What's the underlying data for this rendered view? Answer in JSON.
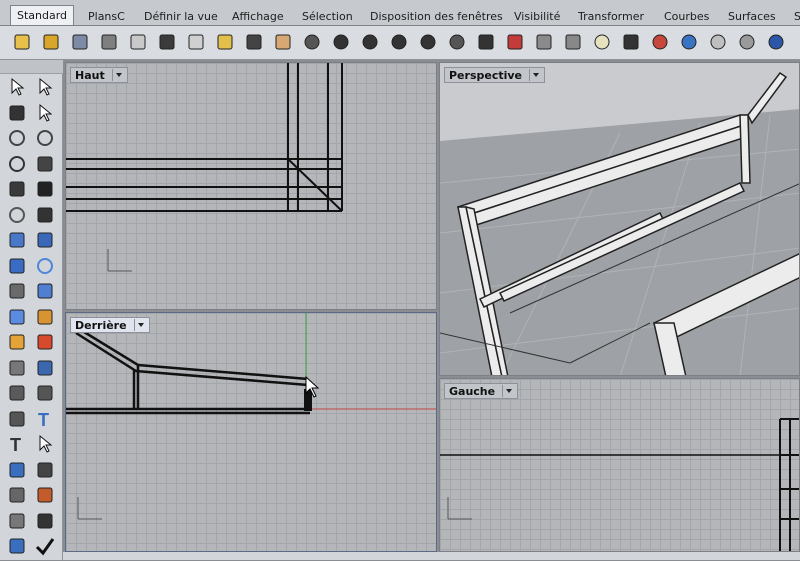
{
  "tabs": [
    "Standard",
    "PlansC",
    "Définir la vue",
    "Affichage",
    "Sélection",
    "Disposition des fenêtres",
    "Visibilité",
    "Transformer",
    "Courbes",
    "Surfaces",
    "S"
  ],
  "active_tab": "Standard",
  "toolbar_icons": [
    "new-file-icon",
    "open-folder-icon",
    "save-icon",
    "print-icon",
    "import-icon",
    "cut-icon",
    "copy-icon",
    "paste-icon",
    "undo-icon",
    "pan-hand-icon",
    "rotate-view-icon",
    "zoom-icon",
    "zoom-window-icon",
    "zoom-extents-icon",
    "zoom-selected-icon",
    "rotate-3d-icon",
    "four-viewports-icon",
    "red-plane-icon",
    "layer-icon",
    "properties-icon",
    "light-bulb-icon",
    "lock-icon",
    "material-icon",
    "render-color-icon",
    "sphere-icon",
    "shaded-sphere-icon",
    "rendered-sphere-icon"
  ],
  "palette_icons": [
    "select-arrow-icon",
    "point-icon",
    "polyline-icon",
    "curve-points-icon",
    "circle-icon",
    "ellipse-icon",
    "arc-icon",
    "rectangle-icon",
    "polygon-icon",
    "freeform-curve-icon",
    "circle-center-icon",
    "fillet-icon",
    "surface-icon",
    "loft-icon",
    "box-solid-icon",
    "sphere-solid-icon",
    "extrude-icon",
    "boolean-icon",
    "cylinder-icon",
    "pipe-icon",
    "transform-icon",
    "array-icon",
    "split-icon",
    "join-icon",
    "mesh-icon",
    "render-icon",
    "dimension-icon",
    "text-icon",
    "text-tool-icon",
    "edit-point-icon",
    "group-icon",
    "block-icon",
    "analyze-icon",
    "chart-icon",
    "grid-icon",
    "history-icon",
    "render-teapot-icon",
    "check-icon"
  ],
  "viewports": {
    "top": {
      "label": "Haut",
      "active": false
    },
    "back": {
      "label": "Derrière",
      "active": true
    },
    "perspective": {
      "label": "Perspective",
      "active": false
    },
    "left": {
      "label": "Gauche",
      "active": false
    }
  }
}
